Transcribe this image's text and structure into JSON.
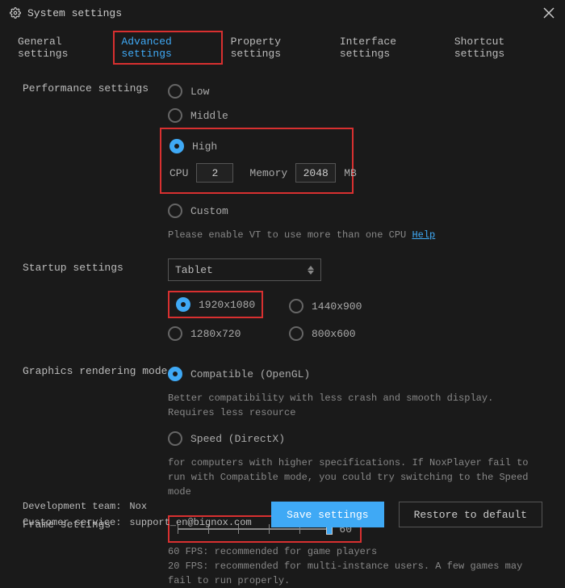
{
  "title": "System settings",
  "tabs": [
    "General settings",
    "Advanced settings",
    "Property settings",
    "Interface settings",
    "Shortcut settings"
  ],
  "active_tab": 1,
  "performance": {
    "label": "Performance settings",
    "options": [
      "Low",
      "Middle",
      "High",
      "Custom"
    ],
    "selected": "High",
    "cpu_label": "CPU",
    "cpu_value": "2",
    "mem_label": "Memory",
    "mem_value": "2048",
    "mem_unit": "MB",
    "vt_hint": "Please enable VT to use more than one CPU",
    "vt_link": "Help"
  },
  "startup": {
    "label": "Startup settings",
    "mode": "Tablet",
    "resolutions": [
      "1920x1080",
      "1440x900",
      "1280x720",
      "800x600"
    ],
    "selected": "1920x1080"
  },
  "graphics": {
    "label": "Graphics rendering mode",
    "opt_compat": "Compatible (OpenGL)",
    "compat_desc": "Better compatibility with less crash and smooth display. Requires less resource",
    "opt_speed": "Speed (DirectX)",
    "speed_desc": "for computers with higher specifications. If NoxPlayer fail to run with Compatible mode, you could try switching to the Speed mode",
    "selected": "compat"
  },
  "frame": {
    "label": "Frame settings",
    "value": "60",
    "hint1": "60 FPS: recommended for game players",
    "hint2": "20 FPS: recommended for multi-instance users. A few games may fail to run properly."
  },
  "footer": {
    "dev_label": "Development team:",
    "dev_value": "Nox",
    "cs_label": "Customer service:",
    "cs_value": "support_en@bignox.com",
    "save": "Save settings",
    "restore": "Restore to default"
  }
}
